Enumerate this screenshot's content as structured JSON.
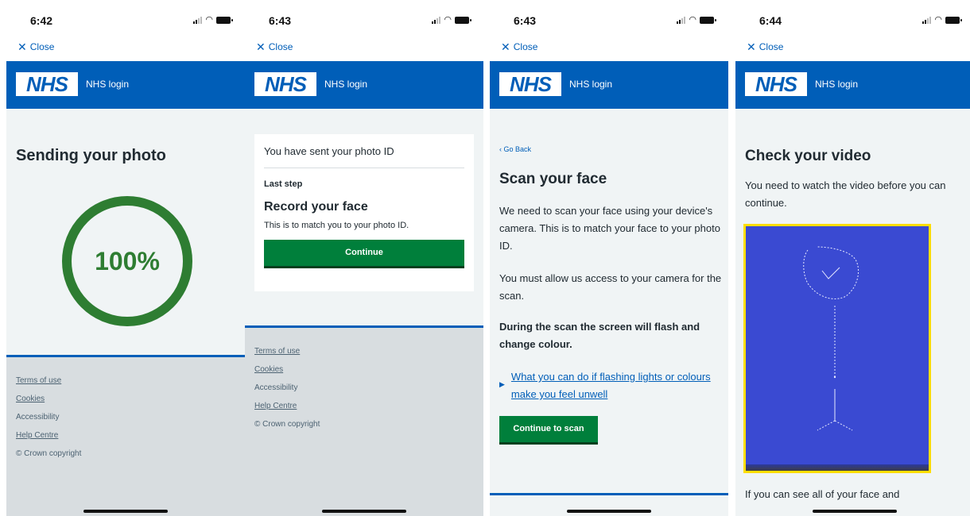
{
  "screens": [
    {
      "status_time": "6:42",
      "close_label": "Close",
      "logo_text": "NHS",
      "header_title": "NHS login",
      "title": "Sending your photo",
      "progress_percent": 100,
      "progress_label": "100%",
      "footer_links": [
        "Terms of use",
        "Cookies",
        "Accessibility",
        "Help Centre"
      ],
      "copyright": "© Crown copyright"
    },
    {
      "status_time": "6:43",
      "close_label": "Close",
      "logo_text": "NHS",
      "header_title": "NHS login",
      "sent_text": "You have sent your photo ID",
      "last_step": "Last step",
      "record_title": "Record your face",
      "match_text": "This is to match you to your photo ID.",
      "continue_label": "Continue",
      "footer_links": [
        "Terms of use",
        "Cookies",
        "Accessibility",
        "Help Centre"
      ],
      "copyright": "© Crown copyright"
    },
    {
      "status_time": "6:43",
      "close_label": "Close",
      "logo_text": "NHS",
      "header_title": "NHS login",
      "go_back": "‹ Go Back",
      "title": "Scan your face",
      "para1": "We need to scan your face using your device's camera. This is to match your face to your photo ID.",
      "para2": "You must allow us access to your camera for the scan.",
      "para3": "During the scan the screen will flash and change colour.",
      "details_link": "What you can do if flashing lights or colours make you feel unwell",
      "button_label": "Continue to scan"
    },
    {
      "status_time": "6:44",
      "close_label": "Close",
      "logo_text": "NHS",
      "header_title": "NHS login",
      "title": "Check your video",
      "para1": "You need to watch the video before you can continue.",
      "para2": "If you can see all of your face and"
    }
  ],
  "colors": {
    "nhs_blue": "#005eb8",
    "green": "#007f3b",
    "progress_green": "#2e7d32",
    "video_bg": "#3a4ad2",
    "video_border": "#ffde00"
  }
}
